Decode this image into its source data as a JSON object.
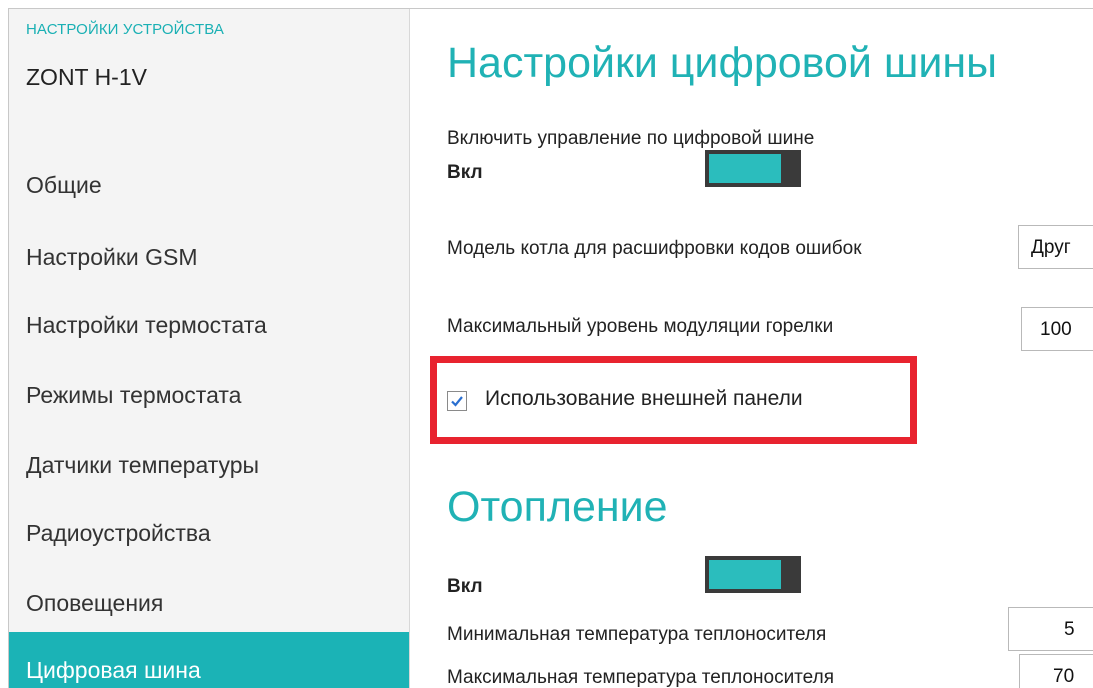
{
  "sidebar": {
    "caption": "НАСТРОЙКИ УСТРОЙСТВА",
    "device": "ZONT H-1V",
    "items": [
      {
        "label": "Общие"
      },
      {
        "label": "Настройки GSM"
      },
      {
        "label": "Настройки термостата"
      },
      {
        "label": "Режимы термостата"
      },
      {
        "label": "Датчики температуры"
      },
      {
        "label": "Радиоустройства"
      },
      {
        "label": "Оповещения"
      },
      {
        "label": "Цифровая шина"
      }
    ],
    "active_item": "Цифровая шина"
  },
  "digital_bus": {
    "title": "Настройки цифровой шины",
    "enable_label": "Включить управление по цифровой шине",
    "enable_state": "Вкл",
    "enable_on": true,
    "boiler_model_label": "Модель котла для расшифровки кодов ошибок",
    "boiler_model_value": "Друг",
    "max_modulation_label": "Максимальный уровень модуляции горелки",
    "max_modulation_value": "100",
    "external_panel_label": "Использование внешней панели",
    "external_panel_checked": true
  },
  "heating": {
    "title": "Отопление",
    "state": "Вкл",
    "on": true,
    "min_temp_label": "Минимальная температура теплоносителя",
    "min_temp_value": "5",
    "max_temp_label": "Максимальная температура теплоносителя",
    "max_temp_value": "70"
  },
  "colors": {
    "accent": "#1bb3b6",
    "highlight": "#e8232f",
    "sidebar_bg": "#f4f4f4"
  }
}
